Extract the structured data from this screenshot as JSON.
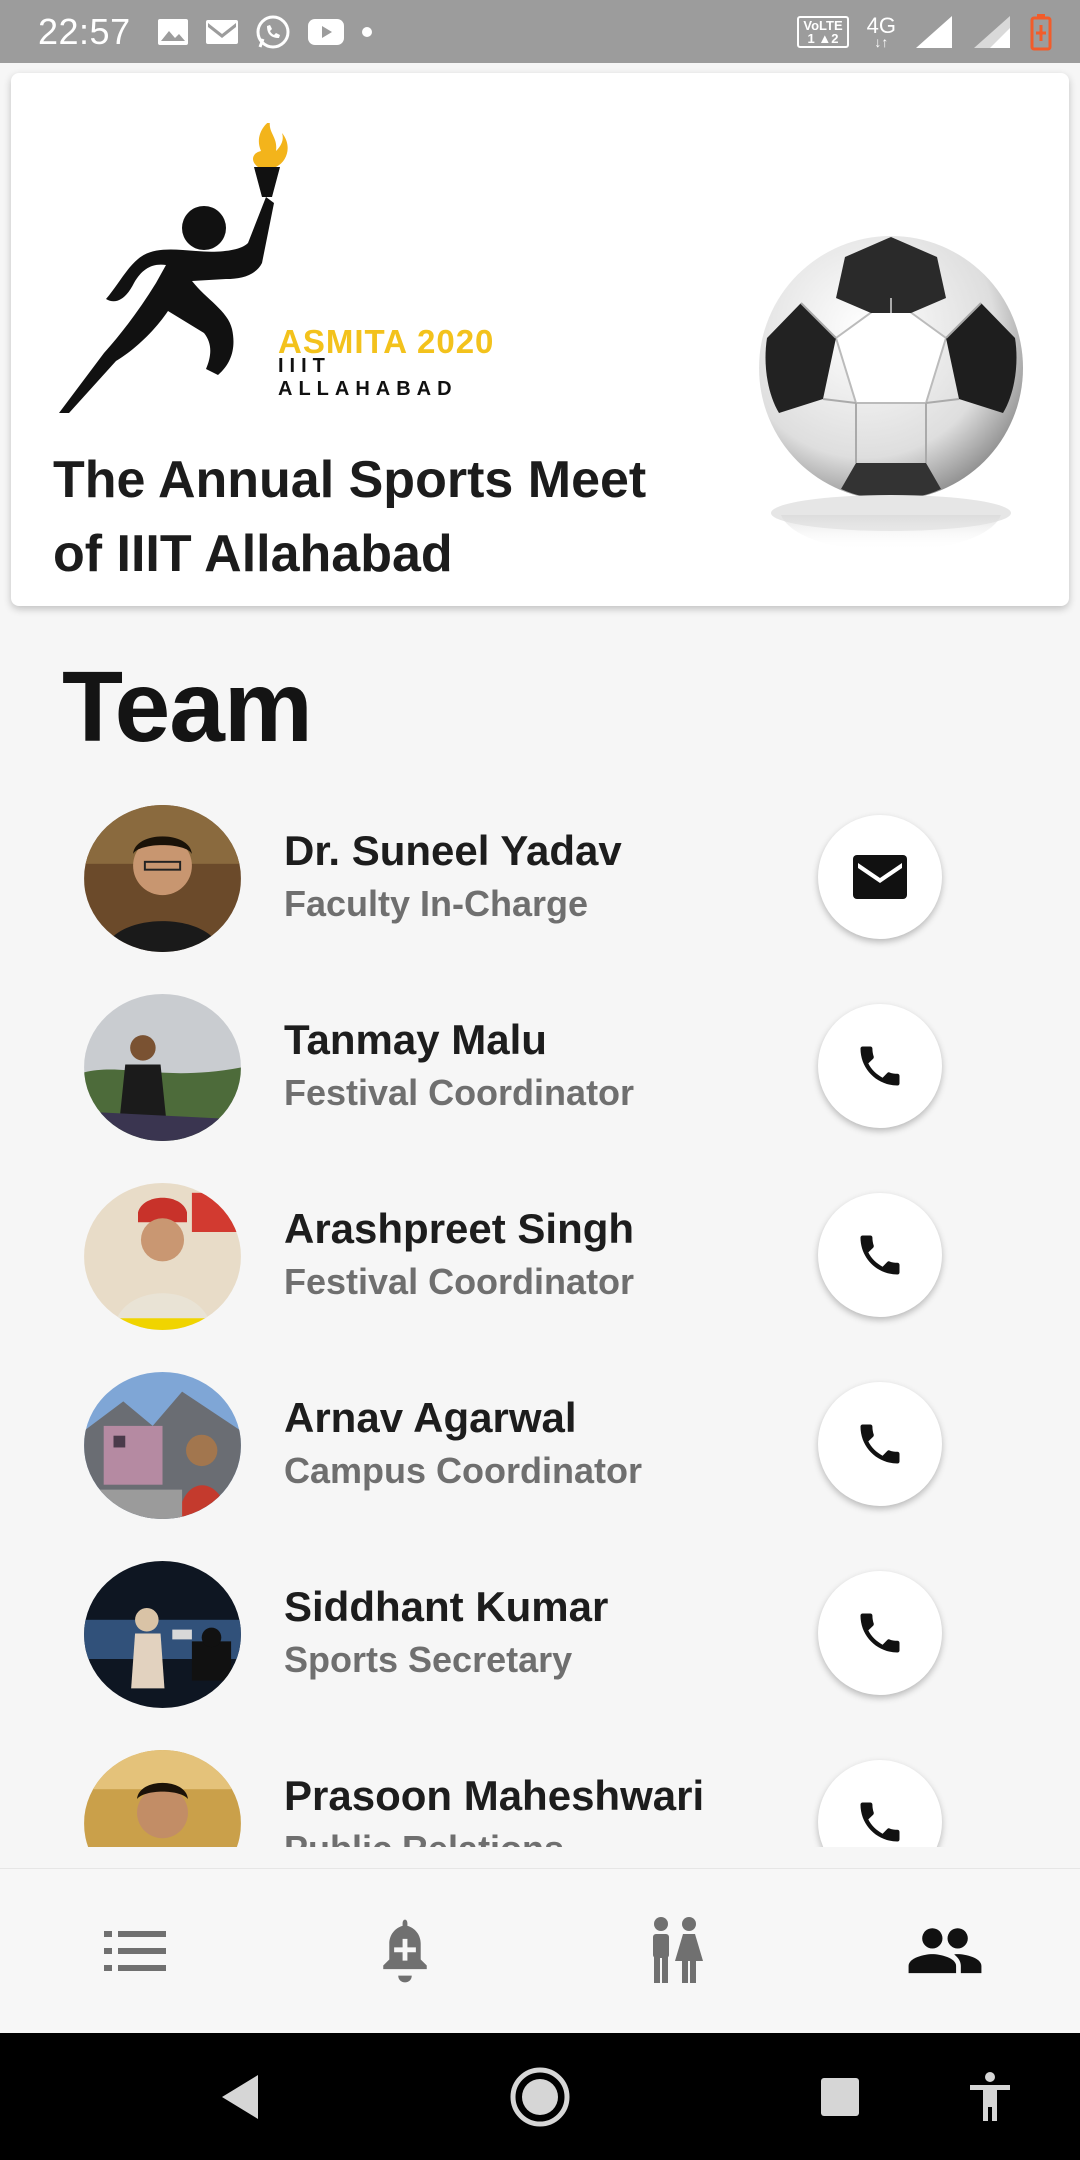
{
  "status_bar": {
    "time": "22:57",
    "left_icons": [
      "gallery-icon",
      "gmail-icon",
      "whatsapp-icon",
      "youtube-icon",
      "dot-icon"
    ],
    "volte": "VoLTE",
    "volte_sim": "1 ▲2",
    "network": "4G",
    "battery_color": "#f25c2a"
  },
  "header": {
    "logo_title": "ASMITA 2020",
    "logo_subtitle": "IIIT ALLAHABAD",
    "tagline_line1": "The Annual Sports Meet",
    "tagline_line2": "of IIIT Allahabad",
    "logo_accent_color": "#f3c21c"
  },
  "team": {
    "title": "Team",
    "members": [
      {
        "name": "Dr. Suneel Yadav",
        "role": "Faculty In-Charge",
        "action": "mail-icon"
      },
      {
        "name": "Tanmay Malu",
        "role": "Festival Coordinator",
        "action": "phone-icon"
      },
      {
        "name": "Arashpreet Singh",
        "role": "Festival Coordinator",
        "action": "phone-icon"
      },
      {
        "name": "Arnav Agarwal",
        "role": "Campus Coordinator",
        "action": "phone-icon"
      },
      {
        "name": "Siddhant Kumar",
        "role": "Sports Secretary",
        "action": "phone-icon"
      },
      {
        "name": "Prasoon Maheshwari",
        "role": "Public Relations",
        "action": "phone-icon"
      }
    ]
  },
  "bottom_nav": {
    "items": [
      {
        "icon": "list-icon",
        "active": false
      },
      {
        "icon": "notification-add-icon",
        "active": false
      },
      {
        "icon": "people-gender-icon",
        "active": false
      },
      {
        "icon": "team-icon",
        "active": true
      }
    ],
    "active_color": "#111111",
    "inactive_color": "#707070"
  },
  "system_nav": {
    "buttons": [
      "back-icon",
      "home-icon",
      "recents-icon",
      "accessibility-icon"
    ]
  }
}
